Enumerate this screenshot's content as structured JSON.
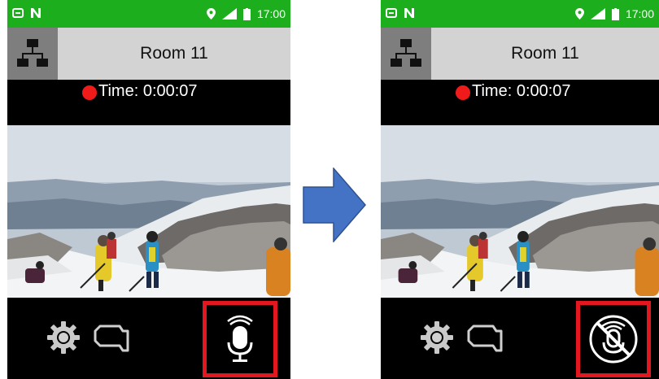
{
  "colors": {
    "status_bar": "#1dae1d",
    "title_bar": "#d3d3d3",
    "recording_dot": "#ef1b1b",
    "highlight_border": "#e3171f",
    "arrow": "#4472c4"
  },
  "before": {
    "status_bar": {
      "time": "17:00"
    },
    "room_title": "Room 11",
    "recording_time": "Time: 0:00:07",
    "mic_state": "mic-on",
    "icons": [
      "network-icon",
      "gear-icon",
      "camera-icon",
      "microphone-icon"
    ]
  },
  "after": {
    "status_bar": {
      "time": "17:00"
    },
    "room_title": "Room 11",
    "recording_time": "Time: 0:00:07",
    "mic_state": "mic-off",
    "icons": [
      "network-icon",
      "gear-icon",
      "camera-icon",
      "microphone-off-icon"
    ]
  },
  "transition_icon": "right-arrow-icon"
}
